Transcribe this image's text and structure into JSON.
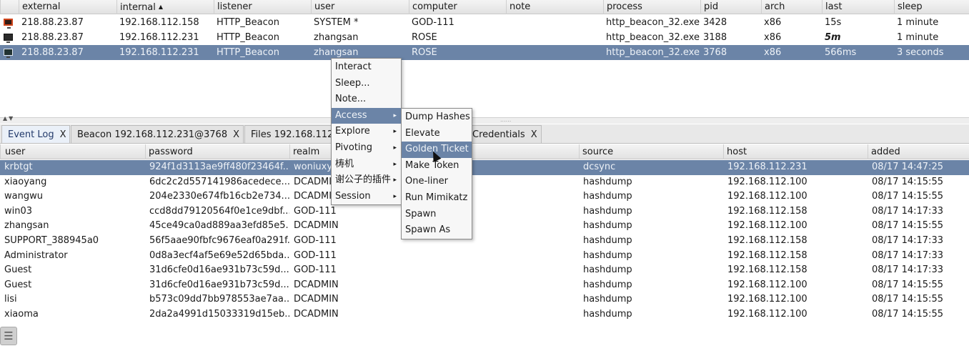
{
  "beacon_table": {
    "columns": [
      "external",
      "internal",
      "listener",
      "user",
      "computer",
      "note",
      "process",
      "pid",
      "arch",
      "last",
      "sleep"
    ],
    "sort_column": "internal",
    "rows": [
      {
        "icon": "beacon-monitor-icon",
        "external": "218.88.23.87",
        "internal": "192.168.112.158",
        "listener": "HTTP_Beacon",
        "user": "SYSTEM *",
        "computer": "GOD-111",
        "note": "",
        "process": "http_beacon_32.exe",
        "pid": "3428",
        "arch": "x86",
        "last": "15s",
        "sleep": "1 minute"
      },
      {
        "icon": "beacon-monitor-icon",
        "external": "218.88.23.87",
        "internal": "192.168.112.231",
        "listener": "HTTP_Beacon",
        "user": "zhangsan",
        "computer": "ROSE",
        "note": "",
        "process": "http_beacon_32.exe",
        "pid": "3188",
        "arch": "x86",
        "last": "5m",
        "sleep": "1 minute"
      },
      {
        "icon": "beacon-monitor-icon",
        "external": "218.88.23.87",
        "internal": "192.168.112.231",
        "listener": "HTTP_Beacon",
        "user": "zhangsan",
        "computer": "ROSE",
        "note": "",
        "process": "http_beacon_32.exe",
        "pid": "3768",
        "arch": "x86",
        "last": "566ms",
        "sleep": "3 seconds"
      }
    ],
    "selected_row": 2
  },
  "tabs": [
    {
      "label": "Event Log",
      "close": "X"
    },
    {
      "label": "Beacon 192.168.112.231@3768",
      "close": "X"
    },
    {
      "label": "Files 192.168.112",
      "close": ""
    },
    {
      "label": "Credentials",
      "close": "X"
    }
  ],
  "credentials_table": {
    "columns": [
      "user",
      "password",
      "realm",
      "source",
      "host",
      "added"
    ],
    "rows": [
      {
        "user": "krbtgt",
        "password": "924f1d3113ae9ff480f23464f...",
        "realm": "woniuxy",
        "source": "dcsync",
        "host": "192.168.112.231",
        "added": "08/17 14:47:25"
      },
      {
        "user": "xiaoyang",
        "password": "6dc2c2d557141986acedece...",
        "realm": "DCADMIN",
        "source": "hashdump",
        "host": "192.168.112.100",
        "added": "08/17 14:15:55"
      },
      {
        "user": "wangwu",
        "password": "204e2330e674fb16cb2e734...",
        "realm": "DCADMIN",
        "source": "hashdump",
        "host": "192.168.112.100",
        "added": "08/17 14:15:55"
      },
      {
        "user": "win03",
        "password": "ccd8dd79120564f0e1ce9dbf...",
        "realm": "GOD-111",
        "source": "hashdump",
        "host": "192.168.112.158",
        "added": "08/17 14:17:33"
      },
      {
        "user": "zhangsan",
        "password": "45ce49ca0ad889aa3efd85e5...",
        "realm": "DCADMIN",
        "source": "hashdump",
        "host": "192.168.112.100",
        "added": "08/17 14:15:55"
      },
      {
        "user": "SUPPORT_388945a0",
        "password": "56f5aae90fbfc9676eaf0a291f...",
        "realm": "GOD-111",
        "source": "hashdump",
        "host": "192.168.112.158",
        "added": "08/17 14:17:33"
      },
      {
        "user": "Administrator",
        "password": "0d8a3ecf4af5e69e52d65bda...",
        "realm": "GOD-111",
        "source": "hashdump",
        "host": "192.168.112.158",
        "added": "08/17 14:17:33"
      },
      {
        "user": "Guest",
        "password": "31d6cfe0d16ae931b73c59d...",
        "realm": "GOD-111",
        "source": "hashdump",
        "host": "192.168.112.158",
        "added": "08/17 14:17:33"
      },
      {
        "user": "Guest",
        "password": "31d6cfe0d16ae931b73c59d...",
        "realm": "DCADMIN",
        "source": "hashdump",
        "host": "192.168.112.100",
        "added": "08/17 14:15:55"
      },
      {
        "user": "lisi",
        "password": "b573c09dd7bb978553ae7aa...",
        "realm": "DCADMIN",
        "source": "hashdump",
        "host": "192.168.112.100",
        "added": "08/17 14:15:55"
      },
      {
        "user": "xiaoma",
        "password": "2da2a4991d15033319d15eb...",
        "realm": "DCADMIN",
        "source": "hashdump",
        "host": "192.168.112.100",
        "added": "08/17 14:15:55"
      }
    ],
    "selected_row": 0
  },
  "context_menu": {
    "items": [
      {
        "label": "Interact",
        "submenu": false
      },
      {
        "label": "Sleep...",
        "submenu": false
      },
      {
        "label": "Note...",
        "submenu": false
      },
      {
        "label": "Access",
        "submenu": true
      },
      {
        "label": "Explore",
        "submenu": true
      },
      {
        "label": "Pivoting",
        "submenu": true
      },
      {
        "label": "梼机",
        "submenu": true
      },
      {
        "label": "谢公子的插件",
        "submenu": true
      },
      {
        "label": "Session",
        "submenu": true
      }
    ],
    "highlighted": "Access",
    "submenu_arrow": "▸"
  },
  "access_submenu": {
    "items": [
      "Dump Hashes",
      "Elevate",
      "Golden Ticket",
      "Make Token",
      "One-liner",
      "Run Mimikatz",
      "Spawn",
      "Spawn As"
    ],
    "highlighted": "Golden Ticket"
  },
  "colors": {
    "selection": "#6b84a7",
    "header": "#e2e2e2",
    "menu": "#f7f7f7"
  }
}
